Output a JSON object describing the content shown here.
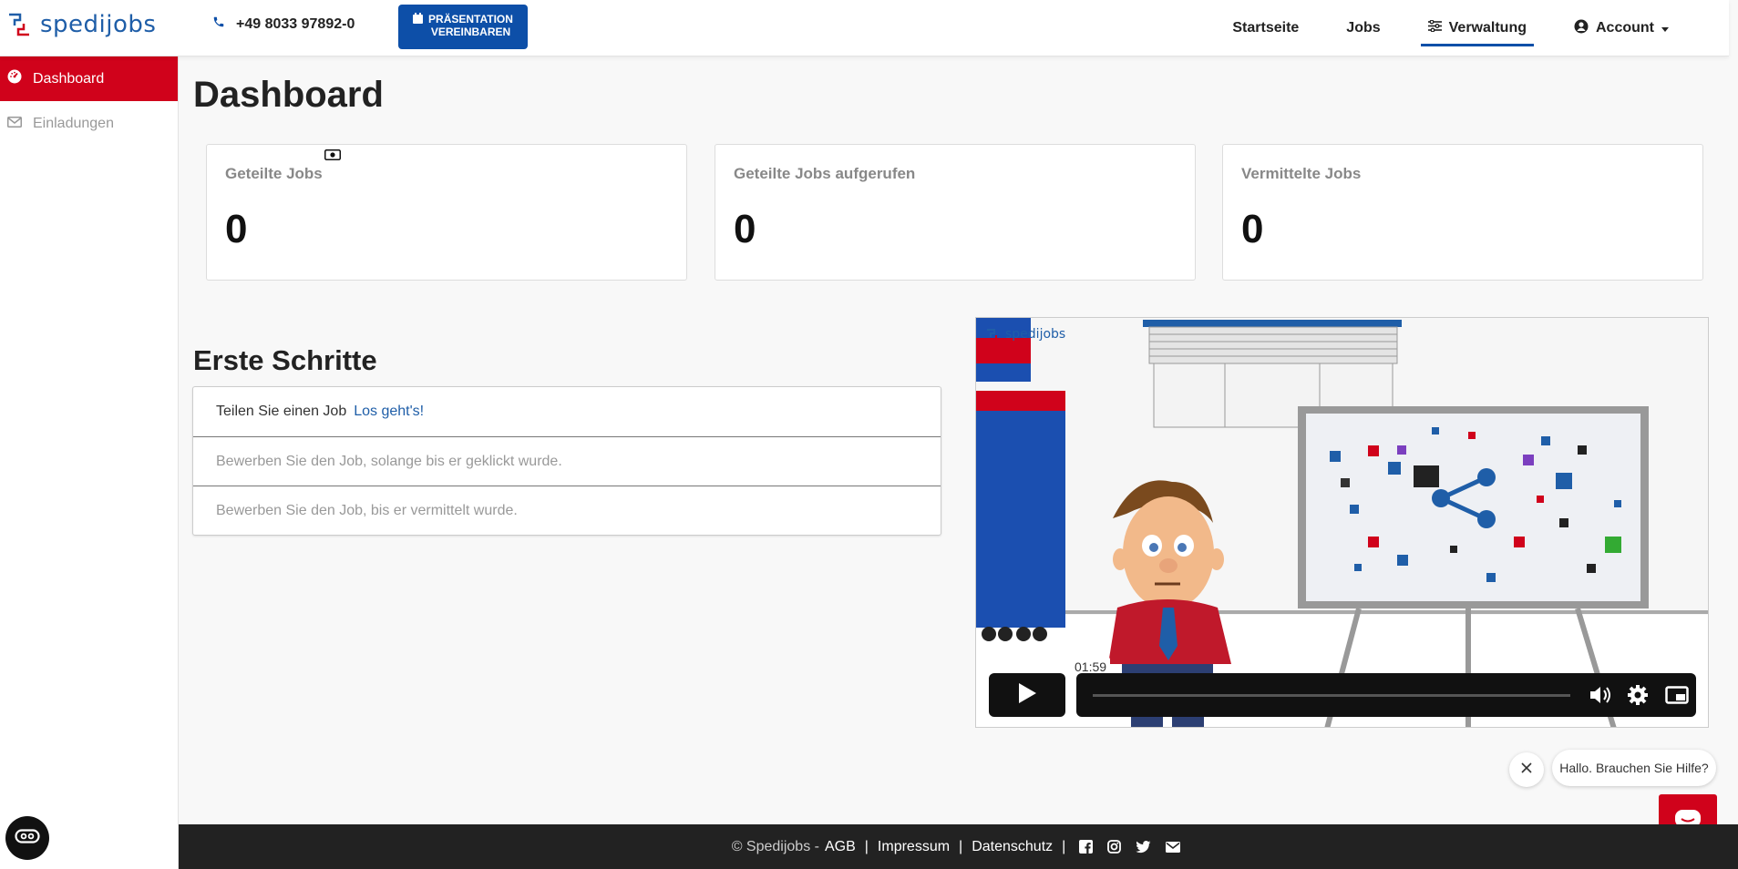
{
  "header": {
    "logo_text": "spedijobs",
    "phone": "+49 8033 97892-0",
    "present_button": {
      "line1": "PRÄSENTATION",
      "line2": "VEREINBAREN"
    },
    "nav": [
      {
        "label": "Startseite"
      },
      {
        "label": "Jobs"
      },
      {
        "label": "Verwaltung"
      },
      {
        "label": "Account"
      }
    ]
  },
  "sidebar": {
    "items": [
      {
        "label": "Dashboard"
      },
      {
        "label": "Einladungen"
      }
    ]
  },
  "main": {
    "title": "Dashboard",
    "cards": [
      {
        "label": "Geteilte Jobs",
        "value": "0"
      },
      {
        "label": "Geteilte Jobs aufgerufen",
        "value": "0"
      },
      {
        "label": "Vermittelte Jobs",
        "value": "0"
      }
    ],
    "steps_title": "Erste Schritte",
    "steps": [
      {
        "text": "Teilen Sie einen Job",
        "link": "Los geht's!"
      },
      {
        "text": "Bewerben Sie den Job, solange bis er geklickt wurde."
      },
      {
        "text": "Bewerben Sie den Job, bis er vermittelt wurde."
      }
    ]
  },
  "video": {
    "watermark": "spedijobs",
    "time": "01:59"
  },
  "chat": {
    "bubble_text": "Hallo. Brauchen Sie Hilfe?"
  },
  "footer": {
    "copyright": "© Spedijobs -",
    "links": [
      "AGB",
      "Impressum",
      "Datenschutz"
    ]
  },
  "colors": {
    "accent_red": "#d0021b",
    "brand_blue": "#0d4fa8",
    "footer_bg": "#222222"
  }
}
